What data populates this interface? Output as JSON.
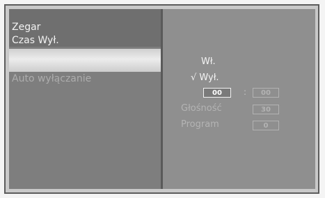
{
  "left_menu": {
    "items": [
      {
        "label": "Zegar"
      },
      {
        "label": "Czas Wył."
      },
      {
        "label": ""
      },
      {
        "label": "Auto wyłączanie"
      }
    ]
  },
  "right_panel": {
    "option_on": "Wł.",
    "option_off": "√ Wył.",
    "time_hour": "00",
    "time_separator": ":",
    "time_minute": "00",
    "volume_label": "Głośność",
    "volume_value": "30",
    "program_label": "Program",
    "program_value": "0"
  },
  "colors": {
    "panel_left": "#7e7e7e",
    "panel_right": "#8f8f8f",
    "highlight": "#e4e4e4",
    "frame": "#5c5c5c"
  }
}
